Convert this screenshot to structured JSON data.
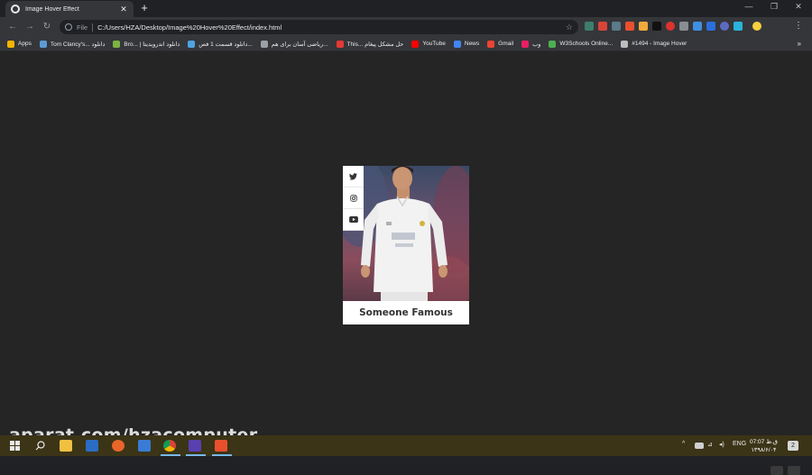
{
  "browser": {
    "tab_title": "Image Hover Effect",
    "tab_close": "✕",
    "new_tab": "+",
    "window_controls": {
      "minimize": "—",
      "restore": "❐",
      "close": "✕"
    },
    "nav": {
      "back": "←",
      "forward": "→",
      "reload": "↻"
    },
    "address": {
      "scheme": "File",
      "url": "C:/Users/HZA/Desktop/Image%20Hover%20Effect/index.html",
      "star": "☆"
    },
    "menu": "⋮"
  },
  "bookmarks": {
    "items": [
      {
        "label": "Apps",
        "icon": "apps-grid-icon",
        "color": "#f4b400"
      },
      {
        "label": "Tom Clancy's... دانلود",
        "icon": "bookmark-icon",
        "color": "#5b9bd5"
      },
      {
        "label": "Bro... | دانلود اندرویدیتا",
        "icon": "android-icon",
        "color": "#7cb342"
      },
      {
        "label": "دانلود قسمت 1 فص...",
        "icon": "bookmark-icon",
        "color": "#4fa3e0"
      },
      {
        "label": "ریاضی آسان برای هم...",
        "icon": "bookmark-icon",
        "color": "#9aa0a6"
      },
      {
        "label": "This... حل مشکل پیغام",
        "icon": "bookmark-icon",
        "color": "#e53935"
      },
      {
        "label": "YouTube",
        "icon": "youtube-icon",
        "color": "#ff0000"
      },
      {
        "label": "News",
        "icon": "news-icon",
        "color": "#4285f4"
      },
      {
        "label": "Gmail",
        "icon": "gmail-icon",
        "color": "#ea4335"
      },
      {
        "label": "وب",
        "icon": "web-icon",
        "color": "#e91e63"
      },
      {
        "label": "W3Schools Online...",
        "icon": "w3schools-icon",
        "color": "#4caf50"
      },
      {
        "label": "#1494 - Image Hover",
        "icon": "bookmark-icon",
        "color": "#bdbdbd"
      }
    ],
    "more": "»"
  },
  "card": {
    "caption": "Someone Famous",
    "social": [
      "twitter-icon",
      "instagram-icon",
      "youtube-icon"
    ]
  },
  "watermark": "aparat.com/hzacomputer",
  "taskbar": {
    "tray_lang": "ENG",
    "clock_time": "07:07 ق.ظ",
    "clock_date": "۱۳۹۸/۶/۰۴",
    "notification_count": "2"
  },
  "colors": {
    "page_bg": "#252525",
    "card_bg": "#ffffff",
    "taskbar_bg": "#3b3417",
    "caption_text": "#333333"
  }
}
